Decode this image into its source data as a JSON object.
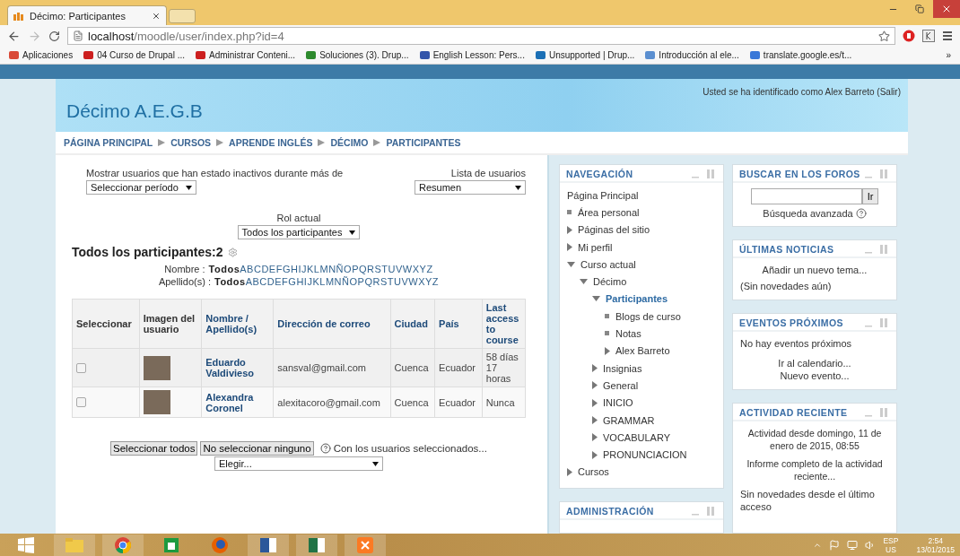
{
  "browser": {
    "tab_title": "Décimo: Participantes",
    "url_host": "localhost",
    "url_path": "/moodle/user/index.php?id=4",
    "bookmarks": [
      {
        "label": "Aplicaciones",
        "color": "#d94a38"
      },
      {
        "label": "04 Curso de Drupal ...",
        "color": "#cc1f1f"
      },
      {
        "label": "Administrar Conteni...",
        "color": "#cc1f1f"
      },
      {
        "label": "Soluciones (3). Drup...",
        "color": "#2d8a2d"
      },
      {
        "label": "English Lesson: Pers...",
        "color": "#3355aa"
      },
      {
        "label": "Unsupported | Drup...",
        "color": "#1b6fb5"
      },
      {
        "label": "Introducción al ele...",
        "color": "#5b8fd0"
      },
      {
        "label": "translate.google.es/t...",
        "color": "#3a78d8"
      }
    ],
    "bookmarks_more": "»"
  },
  "header": {
    "title": "Décimo A.E.G.B",
    "login_prefix": "Usted se ha identificado como",
    "login_user": "Alex Barreto",
    "logout": "(Salir)"
  },
  "breadcrumb": [
    "PÁGINA PRINCIPAL",
    "CURSOS",
    "APRENDE INGLÉS",
    "DÉCIMO",
    "PARTICIPANTES"
  ],
  "main": {
    "inactive_label": "Mostrar usuarios que han estado inactivos durante más de",
    "inactive_select": "Seleccionar período",
    "list_label": "Lista de usuarios",
    "list_select": "Resumen",
    "role_label": "Rol actual",
    "role_select": "Todos los participantes",
    "heading": "Todos los participantes:2",
    "filters": [
      {
        "label": "Nombre :",
        "all": "Todos",
        "letters": [
          "A",
          "B",
          "C",
          "D",
          "E",
          "F",
          "G",
          "H",
          "I",
          "J",
          "K",
          "L",
          "M",
          "N",
          "Ñ",
          "O",
          "P",
          "Q",
          "R",
          "S",
          "T",
          "U",
          "V",
          "W",
          "X",
          "Y",
          "Z"
        ]
      },
      {
        "label": "Apellido(s) :",
        "all": "Todos",
        "letters": [
          "A",
          "B",
          "C",
          "D",
          "E",
          "F",
          "G",
          "H",
          "I",
          "J",
          "K",
          "L",
          "M",
          "N",
          "Ñ",
          "O",
          "P",
          "Q",
          "R",
          "S",
          "T",
          "U",
          "V",
          "W",
          "X",
          "Y",
          "Z"
        ]
      }
    ],
    "table": {
      "columns": [
        {
          "label": "Seleccionar",
          "link": false
        },
        {
          "label": "Imagen del usuario",
          "link": false
        },
        {
          "label": "Nombre / Apellido(s)",
          "link": true
        },
        {
          "label": "Dirección de correo",
          "link": true
        },
        {
          "label": "Ciudad",
          "link": true
        },
        {
          "label": "País",
          "link": true
        },
        {
          "label": "Last access to course",
          "link": true
        }
      ],
      "rows": [
        {
          "selected": false,
          "name": "Eduardo Valdivieso",
          "email": "sansval@gmail.com",
          "city": "Cuenca",
          "country": "Ecuador",
          "last_access": "58 días 17 horas"
        },
        {
          "selected": false,
          "name": "Alexandra Coronel",
          "email": "alexitacoro@gmail.com",
          "city": "Cuenca",
          "country": "Ecuador",
          "last_access": "Nunca"
        }
      ]
    },
    "buttons": [
      "Seleccionar todos",
      "No seleccionar ninguno"
    ],
    "with_selected": "Con los usuarios seleccionados...",
    "action_select": "Elegir..."
  },
  "navigation": {
    "title": "NAVEGACIÓN",
    "items": [
      {
        "label": "Página Principal",
        "kind": "plain",
        "current": false
      },
      {
        "label": "Área personal",
        "kind": "bullet",
        "current": false
      },
      {
        "label": "Páginas del sitio",
        "kind": "branch",
        "expanded": false,
        "current": false
      },
      {
        "label": "Mi perfil",
        "kind": "branch",
        "expanded": false,
        "current": false
      },
      {
        "label": "Curso actual",
        "kind": "branch",
        "expanded": true,
        "current": false,
        "children": [
          {
            "label": "Décimo",
            "kind": "branch",
            "expanded": true,
            "current": false,
            "children": [
              {
                "label": "Participantes",
                "kind": "branch",
                "expanded": true,
                "current": true,
                "children": [
                  {
                    "label": "Blogs de curso",
                    "kind": "bullet",
                    "current": false
                  },
                  {
                    "label": "Notas",
                    "kind": "bullet",
                    "current": false
                  },
                  {
                    "label": "Alex Barreto",
                    "kind": "branch",
                    "expanded": false,
                    "current": false
                  }
                ]
              },
              {
                "label": "Insignias",
                "kind": "branch",
                "expanded": false,
                "current": false
              },
              {
                "label": "General",
                "kind": "branch",
                "expanded": false,
                "current": false
              },
              {
                "label": "INICIO",
                "kind": "branch",
                "expanded": false,
                "current": false
              },
              {
                "label": "GRAMMAR",
                "kind": "branch",
                "expanded": false,
                "current": false
              },
              {
                "label": "VOCABULARY",
                "kind": "branch",
                "expanded": false,
                "current": false
              },
              {
                "label": "PRONUNCIACION",
                "kind": "branch",
                "expanded": false,
                "current": false
              }
            ]
          }
        ]
      },
      {
        "label": "Cursos",
        "kind": "branch",
        "expanded": false,
        "current": false
      }
    ]
  },
  "administration": {
    "title": "ADMINISTRACIÓN"
  },
  "forum_search": {
    "title": "BUSCAR EN LOS FOROS",
    "button": "Ir",
    "advanced": "Búsqueda avanzada"
  },
  "news": {
    "title": "ÚLTIMAS NOTICIAS",
    "add": "Añadir un nuevo tema...",
    "empty": "(Sin novedades aún)"
  },
  "events": {
    "title": "EVENTOS PRÓXIMOS",
    "empty": "No hay eventos próximos",
    "calendar": "Ir al calendario...",
    "new": "Nuevo evento..."
  },
  "activity": {
    "title": "ACTIVIDAD RECIENTE",
    "since": "Actividad desde domingo, 11 de enero de 2015, 08:55",
    "report": "Informe completo de la actividad reciente...",
    "empty": "Sin novedades desde el último acceso"
  },
  "taskbar": {
    "language": "ESP",
    "layout": "US",
    "time": "2:54",
    "date": "13/01/2015"
  }
}
